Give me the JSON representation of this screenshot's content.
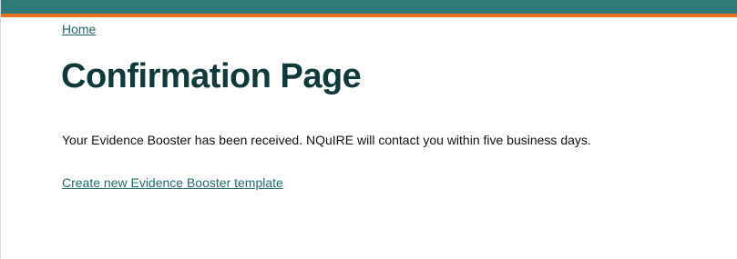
{
  "breadcrumb": {
    "home_label": "Home"
  },
  "page": {
    "title": "Confirmation Page",
    "message": "Your Evidence Booster has been received. NQuIRE will contact you within five business days.",
    "create_link_label": "Create new Evidence Booster template"
  },
  "colors": {
    "header_teal": "#2f7a77",
    "header_orange": "#e8731f",
    "title": "#0f3a3c",
    "link": "#1f6a6d"
  }
}
